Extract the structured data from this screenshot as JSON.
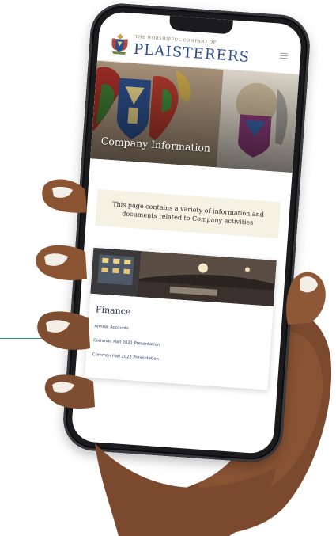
{
  "site": {
    "kicker": "The Worshipful Company of",
    "name": "PLAISTERERS"
  },
  "hero": {
    "title": "Company Information"
  },
  "intro": {
    "text": "This page contains a variety of information and documents related to Company activities"
  },
  "finance": {
    "title": "Finance",
    "links": [
      "Annual Accounts",
      "Common Hall 2021 Presentation",
      "Common Hall 2022 Presentation"
    ]
  },
  "colors": {
    "brand_blue": "#2d4f8c",
    "intro_bg": "#f5f1e3",
    "callout_line": "#2a8a8f",
    "phone_body": "#1b1b1d"
  }
}
